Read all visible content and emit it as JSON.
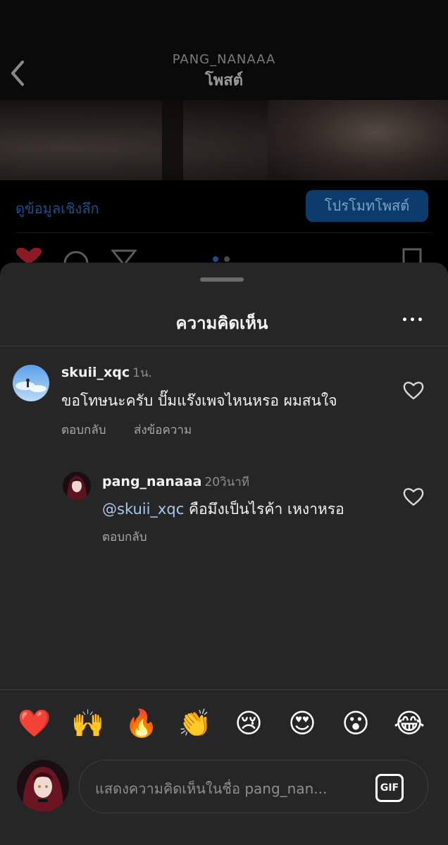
{
  "header": {
    "username": "PANG_NANAAA",
    "title": "โพสต์"
  },
  "post": {
    "insights_label": "ดูข้อมูลเชิงลึก",
    "promote_label": "โปรโมทโพสต์"
  },
  "sheet": {
    "title": "ความคิดเห็น"
  },
  "comments": [
    {
      "username": "skuii_xqc",
      "time": "1น.",
      "text": "ขอโทษนะครับ ปั๊มแร๊งเพจไหนหรอ ผมสนใจ",
      "reply_label": "ตอบกลับ",
      "message_label": "ส่งข้อความ"
    },
    {
      "username": "pang_nanaaa",
      "time": "20วินาที",
      "mention": "@skuii_xqc",
      "text": "คือมึงเป็นไรค้า เหงาหรอ",
      "reply_label": "ตอบกลับ"
    }
  ],
  "emojis": [
    "❤️",
    "🙌",
    "🔥",
    "👏",
    "😢",
    "😍",
    "😮",
    "😂"
  ],
  "composer": {
    "placeholder": "แสดงความคิดเห็นในชื่อ pang_nan...",
    "gif_label": "GIF"
  },
  "colors": {
    "sheet_bg": "#262626",
    "link_blue": "#a8c7f0",
    "promote_bg": "#0c3c6c"
  }
}
